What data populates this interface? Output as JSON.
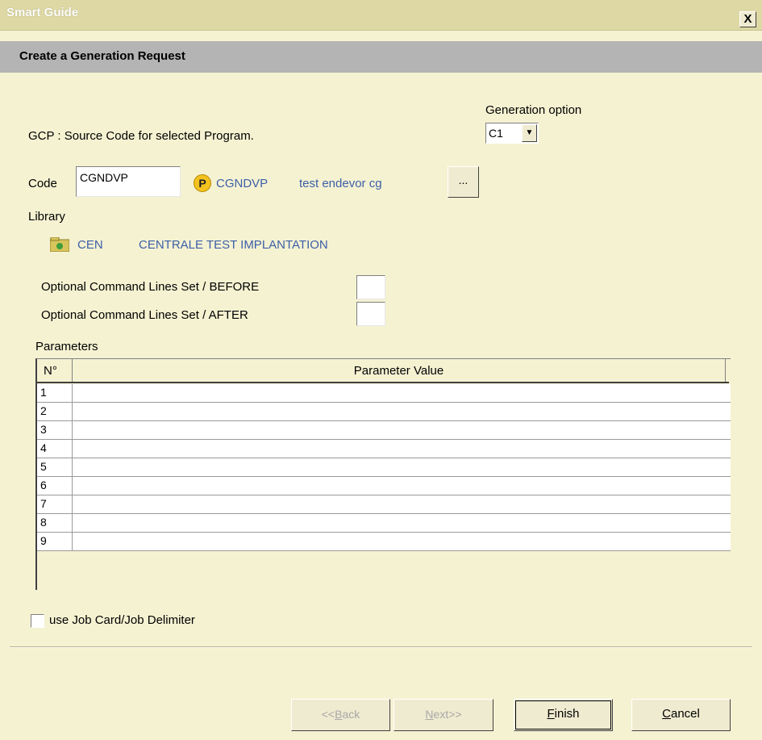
{
  "window": {
    "title": "Smart Guide",
    "close_label": "X"
  },
  "header": {
    "title": "Create a Generation Request"
  },
  "generation_option": {
    "label": "Generation option",
    "selected": "C1"
  },
  "description": "GCP : Source Code for selected Program.",
  "code": {
    "label": "Code",
    "value": "CGNDVP",
    "entity_icon": "P",
    "entity_name": "CGNDVP",
    "entity_desc": "test endevor cg",
    "browse_label": "..."
  },
  "library": {
    "label": "Library",
    "code": "CEN",
    "name": "CENTRALE TEST IMPLANTATION"
  },
  "optional": {
    "before_label": "Optional Command Lines Set / BEFORE",
    "after_label": "Optional Command Lines Set / AFTER",
    "before_value": "",
    "after_value": ""
  },
  "parameters": {
    "label": "Parameters",
    "columns": [
      "N°",
      "Parameter Value"
    ],
    "rows": [
      {
        "no": "1",
        "value": ""
      },
      {
        "no": "2",
        "value": ""
      },
      {
        "no": "3",
        "value": ""
      },
      {
        "no": "4",
        "value": ""
      },
      {
        "no": "5",
        "value": ""
      },
      {
        "no": "6",
        "value": ""
      },
      {
        "no": "7",
        "value": ""
      },
      {
        "no": "8",
        "value": ""
      },
      {
        "no": "9",
        "value": ""
      }
    ]
  },
  "job_card": {
    "label": "use Job Card/Job Delimiter",
    "checked": false
  },
  "buttons": {
    "back": {
      "prefix": "<<",
      "mnemonic": "B",
      "rest": "ack"
    },
    "next": {
      "prefix": "",
      "mnemonic": "N",
      "rest": "ext>>"
    },
    "finish": {
      "mnemonic": "F",
      "rest": "inish"
    },
    "cancel": {
      "mnemonic": "C",
      "rest": "ancel"
    }
  },
  "colors": {
    "background": "#F5F2D2",
    "titlebar": "#DED8A4",
    "header_band": "#B4B4B4",
    "link": "#3C5FA8",
    "icon_yellow": "#F4C21F"
  }
}
